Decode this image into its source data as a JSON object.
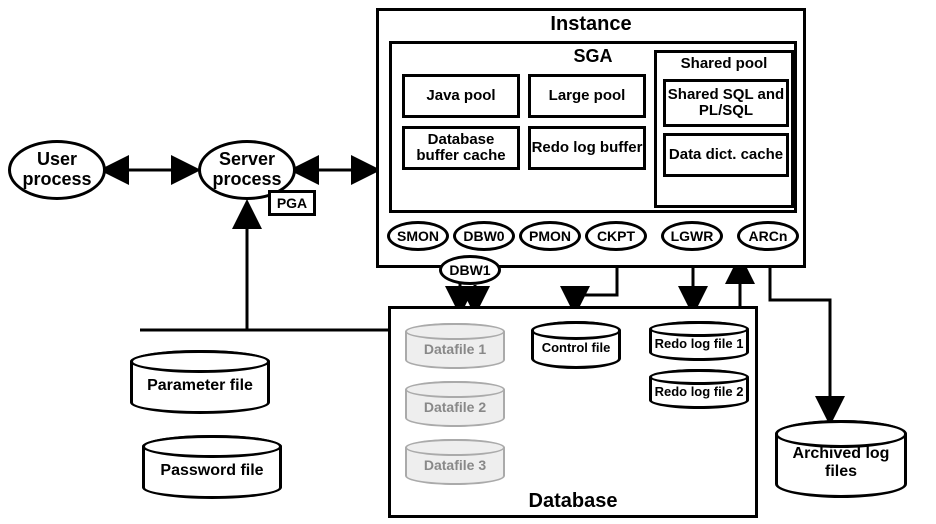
{
  "instance": {
    "title": "Instance",
    "sga": {
      "title": "SGA",
      "pools": {
        "java": "Java pool",
        "large": "Large pool",
        "db_buffer": "Database buffer cache",
        "redo_log": "Redo log buffer"
      },
      "shared_pool": {
        "title": "Shared pool",
        "shared_sql": "Shared SQL and PL/SQL",
        "data_dict": "Data dict. cache"
      }
    },
    "bg_processes": {
      "smon": "SMON",
      "dbw0": "DBW0",
      "dbw1": "DBW1",
      "pmon": "PMON",
      "ckpt": "CKPT",
      "lgwr": "LGWR",
      "arcn": "ARCn"
    }
  },
  "user_process": "User process",
  "server_process": "Server process",
  "pga": "PGA",
  "database": {
    "title": "Database",
    "datafiles": [
      "Datafile 1",
      "Datafile 2",
      "Datafile 3"
    ],
    "control_file": "Control file",
    "redo_logs": [
      "Redo log file 1",
      "Redo log file 2"
    ]
  },
  "parameter_file": "Parameter file",
  "password_file": "Password file",
  "archived_logs": "Archived log files"
}
